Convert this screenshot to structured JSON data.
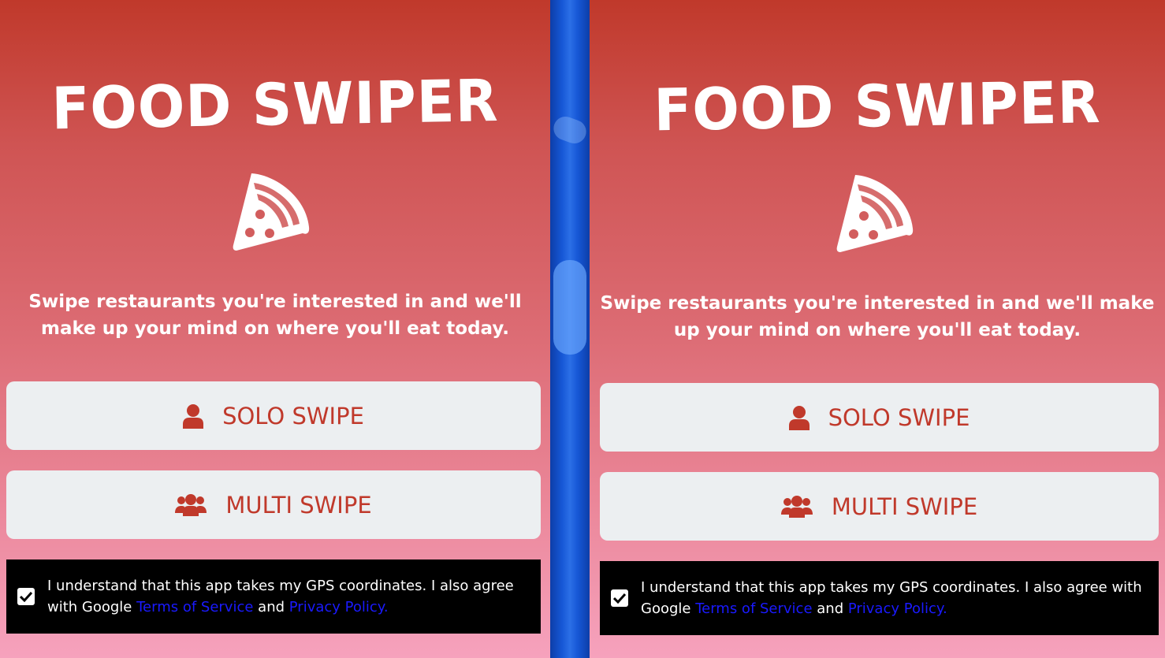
{
  "app": {
    "title": "FOOD SWIPER",
    "tagline": "Swipe restaurants you're interested in and we'll make up your mind on where you'll eat today."
  },
  "buttons": {
    "solo_label": "SOLO SWIPE",
    "multi_label": "MULTI SWIPE"
  },
  "consent": {
    "checked": true,
    "text_before": "I understand that this app takes my GPS coordinates. I also agree with Google ",
    "terms_link": "Terms of Service",
    "text_and": " and ",
    "privacy_link": "Privacy Policy."
  },
  "icons": {
    "logo": "pizza-slice-icon",
    "solo": "user-icon",
    "multi": "users-icon",
    "check": "check-icon"
  },
  "colors": {
    "gradient_top": "#c0392b",
    "gradient_bottom": "#f6a2bd",
    "accent": "#c0392b",
    "button_bg": "#eceff1",
    "consent_bg": "#000000",
    "link": "#1a1aff",
    "divider": "#1657d6"
  }
}
